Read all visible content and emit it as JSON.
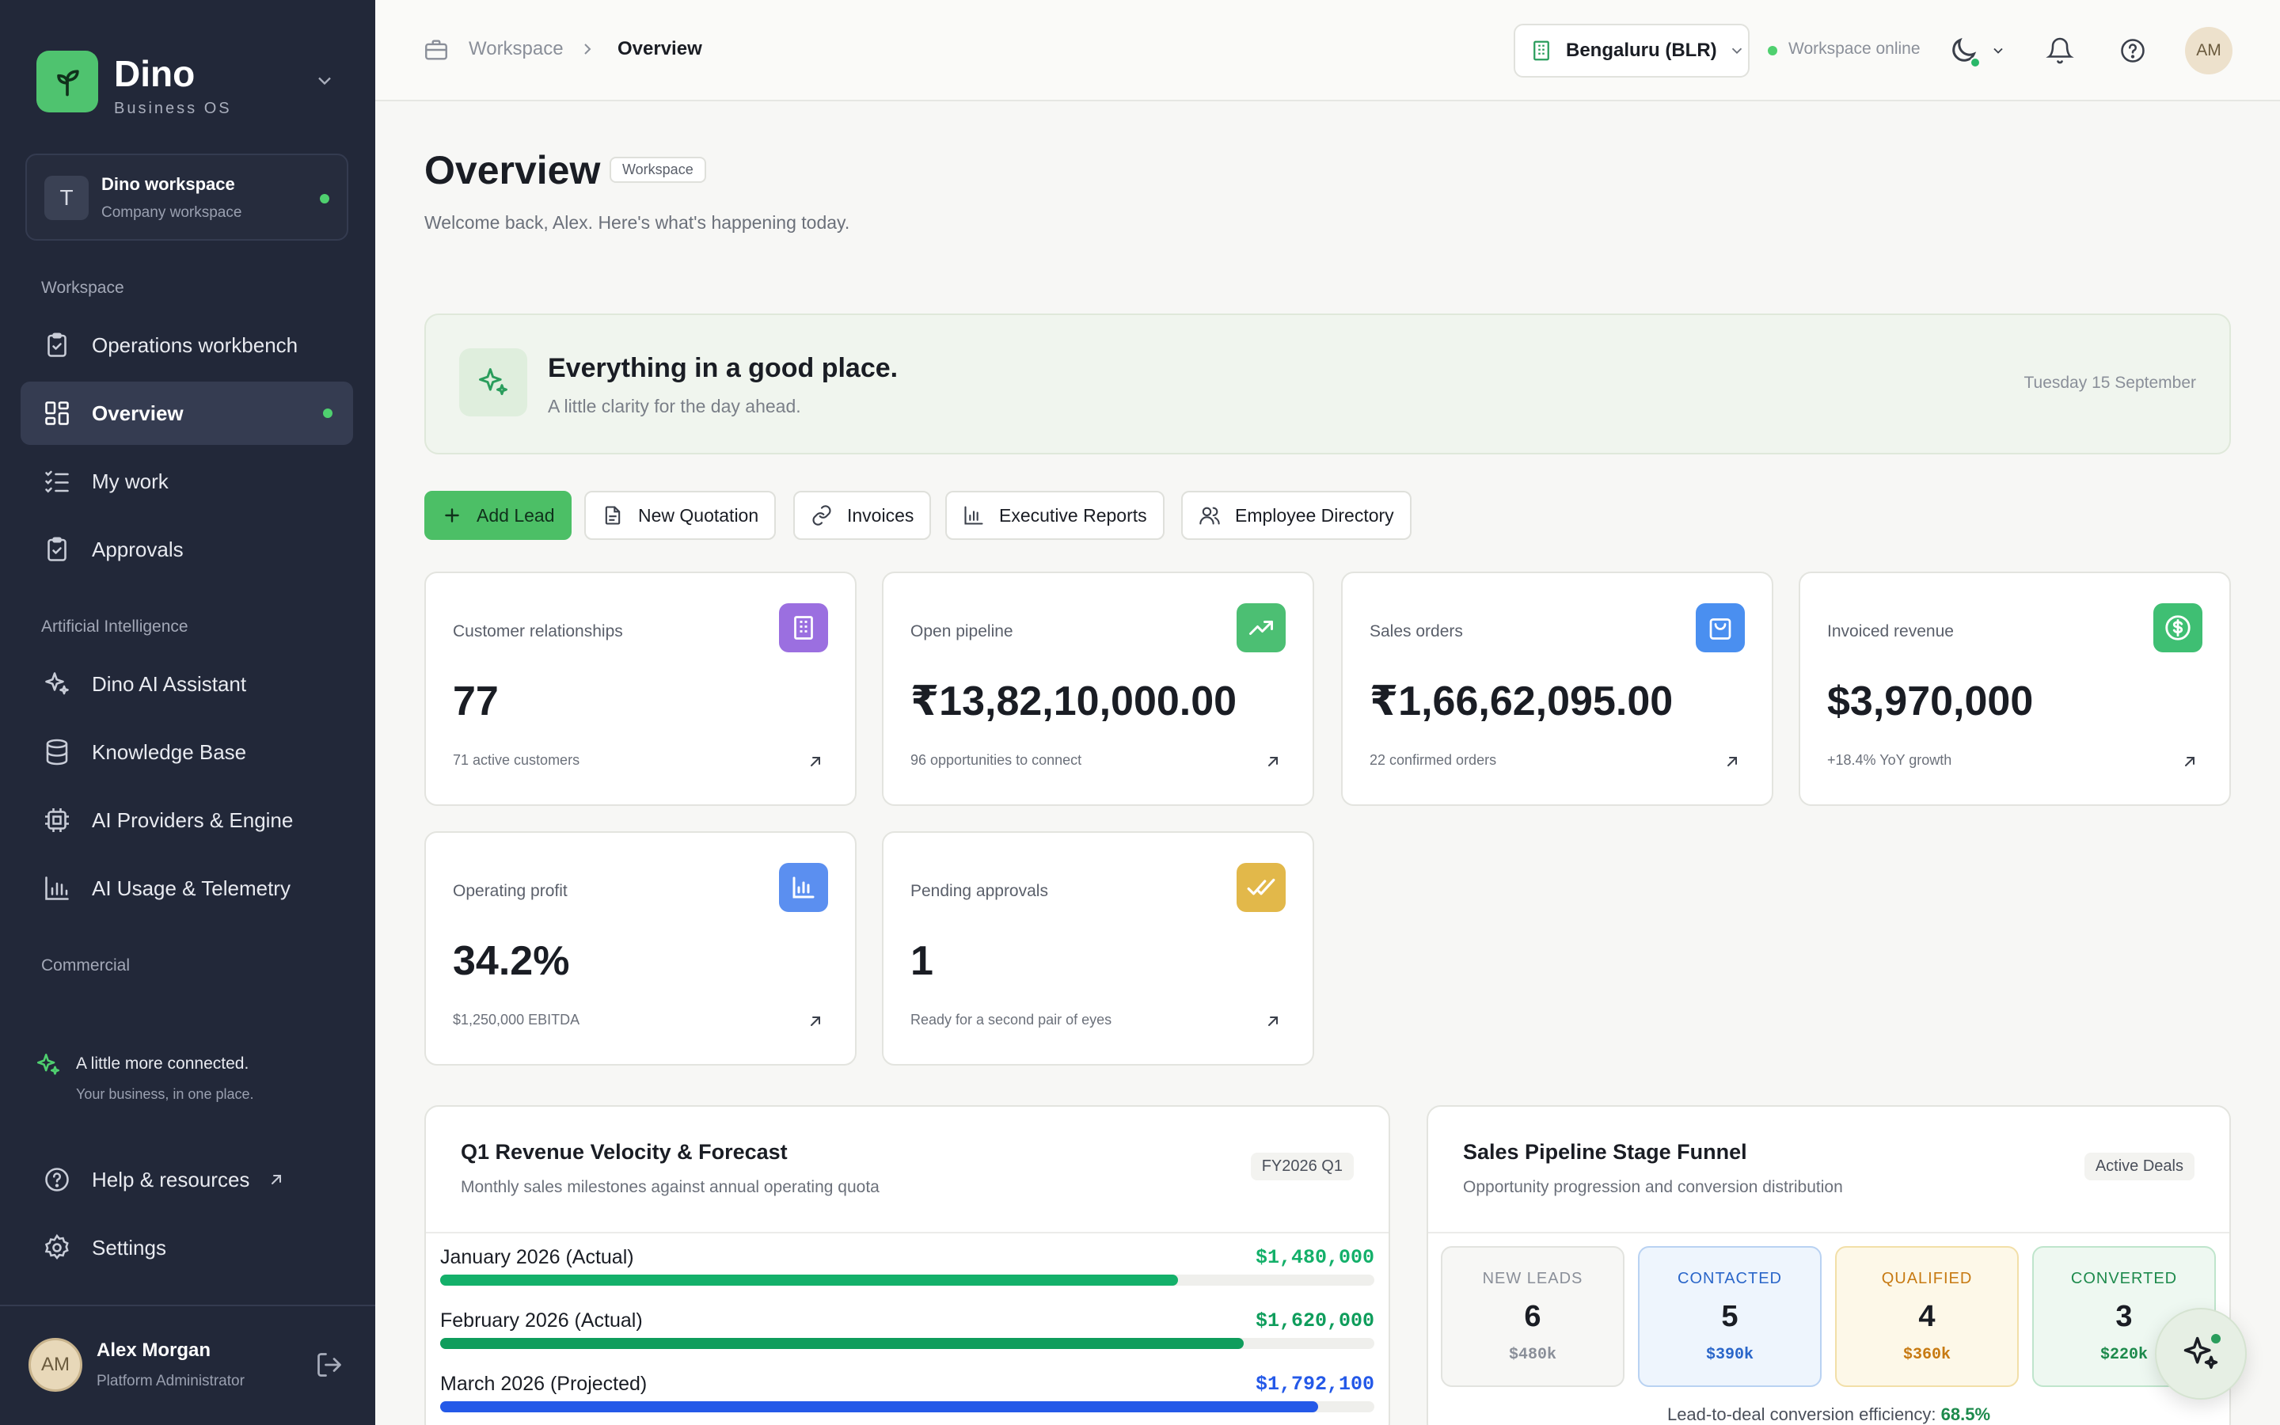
{
  "brand": {
    "name": "Dino",
    "subtitle": "Business OS"
  },
  "workspace_card": {
    "avatar": "T",
    "name": "Dino workspace",
    "type": "Company workspace"
  },
  "sidebar": {
    "section_workspace": "Workspace",
    "items_workspace": [
      {
        "label": "Operations workbench",
        "icon": "clipboard-check-icon"
      },
      {
        "label": "Overview",
        "icon": "layout-grid-icon",
        "active": true
      },
      {
        "label": "My work",
        "icon": "list-checks-icon"
      },
      {
        "label": "Approvals",
        "icon": "clipboard-check-icon"
      }
    ],
    "section_ai": "Artificial Intelligence",
    "items_ai": [
      {
        "label": "Dino AI Assistant",
        "icon": "sparkles-icon"
      },
      {
        "label": "Knowledge Base",
        "icon": "database-icon"
      },
      {
        "label": "AI Providers & Engine",
        "icon": "cpu-icon"
      },
      {
        "label": "AI Usage & Telemetry",
        "icon": "bar-chart-icon"
      }
    ],
    "section_commercial": "Commercial",
    "connect_title": "A little more connected.",
    "connect_sub": "Your business, in one place.",
    "help": "Help & resources",
    "settings": "Settings",
    "user": {
      "initials": "AM",
      "name": "Alex Morgan",
      "role": "Platform Administrator"
    }
  },
  "topbar": {
    "breadcrumb_root": "Workspace",
    "breadcrumb_current": "Overview",
    "location": "Bengaluru (BLR)",
    "status": "Workspace online",
    "avatar": "AM"
  },
  "page": {
    "title": "Overview",
    "badge": "Workspace",
    "welcome": "Welcome back, Alex. Here's what's happening today."
  },
  "hero": {
    "title": "Everything in a good place.",
    "subtitle": "A little clarity for the day ahead.",
    "date": "Tuesday 15 September"
  },
  "quick_actions": [
    "Add Lead",
    "New Quotation",
    "Invoices",
    "Executive Reports",
    "Employee Directory"
  ],
  "kpis": [
    {
      "label": "Customer relationships",
      "value": "77",
      "sub": "71 active customers",
      "color": "#9b6fe0"
    },
    {
      "label": "Open pipeline",
      "value": "₹13,82,10,000.00",
      "sub": "96 opportunities to connect",
      "color": "#4cbf73"
    },
    {
      "label": "Sales orders",
      "value": "₹1,66,62,095.00",
      "sub": "22 confirmed orders",
      "color": "#4a8ff0"
    },
    {
      "label": "Invoiced revenue",
      "value": "$3,970,000",
      "sub": "+18.4% YoY growth",
      "color": "#3fbf73"
    },
    {
      "label": "Operating profit",
      "value": "34.2%",
      "sub": "$1,250,000 EBITDA",
      "color": "#5b8ff0"
    },
    {
      "label": "Pending approvals",
      "value": "1",
      "sub": "Ready for a second pair of eyes",
      "color": "#e2b84a"
    }
  ],
  "revenue": {
    "title": "Q1 Revenue Velocity & Forecast",
    "subtitle": "Monthly sales milestones against annual operating quota",
    "badge": "FY2026 Q1",
    "rows": [
      {
        "label": "January 2026 (Actual)",
        "value": "$1,480,000",
        "fraction": 0.79,
        "color": "#14b06a"
      },
      {
        "label": "February 2026 (Actual)",
        "value": "$1,620,000",
        "fraction": 0.86,
        "color": "#0f9d5c"
      },
      {
        "label": "March 2026 (Projected)",
        "value": "$1,792,100",
        "fraction": 0.94,
        "color": "#2459e8"
      }
    ]
  },
  "funnel": {
    "title": "Sales Pipeline Stage Funnel",
    "subtitle": "Opportunity progression and conversion distribution",
    "badge": "Active Deals",
    "stages": [
      {
        "name": "NEW LEADS",
        "count": "6",
        "value": "$480k",
        "color": "#8a8f99",
        "border": "#e2e3df",
        "bg": "#f7f7f5"
      },
      {
        "name": "CONTACTED",
        "count": "5",
        "value": "$390k",
        "color": "#2a66c9",
        "border": "#b9d2f2",
        "bg": "#eef5fd"
      },
      {
        "name": "QUALIFIED",
        "count": "4",
        "value": "$360k",
        "color": "#c77a12",
        "border": "#f2dfa8",
        "bg": "#fdf8e8"
      },
      {
        "name": "CONVERTED",
        "count": "3",
        "value": "$220k",
        "color": "#1d8a4c",
        "border": "#bfe5cc",
        "bg": "#eef8f1"
      }
    ],
    "conversion_label": "Lead-to-deal conversion efficiency:",
    "conversion_value": "68.5%"
  }
}
